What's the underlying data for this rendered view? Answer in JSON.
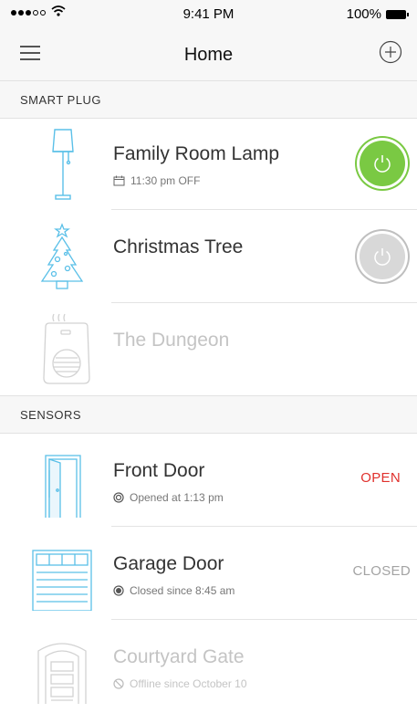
{
  "status_bar": {
    "time": "9:41 PM",
    "battery": "100%"
  },
  "nav": {
    "title": "Home"
  },
  "sections": {
    "plugs": "SMART PLUG",
    "sensors": "SENSORS"
  },
  "plugs": [
    {
      "name": "Family Room Lamp",
      "schedule": "11:30 pm OFF",
      "state": "on"
    },
    {
      "name": "Christmas Tree",
      "state": "off"
    },
    {
      "name": "The Dungeon",
      "state": "offline"
    }
  ],
  "sensors": [
    {
      "name": "Front Door",
      "detail": "Opened at 1:13 pm",
      "status": "OPEN"
    },
    {
      "name": "Garage Door",
      "detail": "Closed since 8:45 am",
      "status": "CLOSED"
    },
    {
      "name": "Courtyard Gate",
      "detail": "Offline since October 10",
      "status": ""
    }
  ],
  "colors": {
    "accent": "#5bc0e8",
    "on": "#7ac943",
    "open": "#e0312d",
    "offline": "#c4c4c4"
  }
}
